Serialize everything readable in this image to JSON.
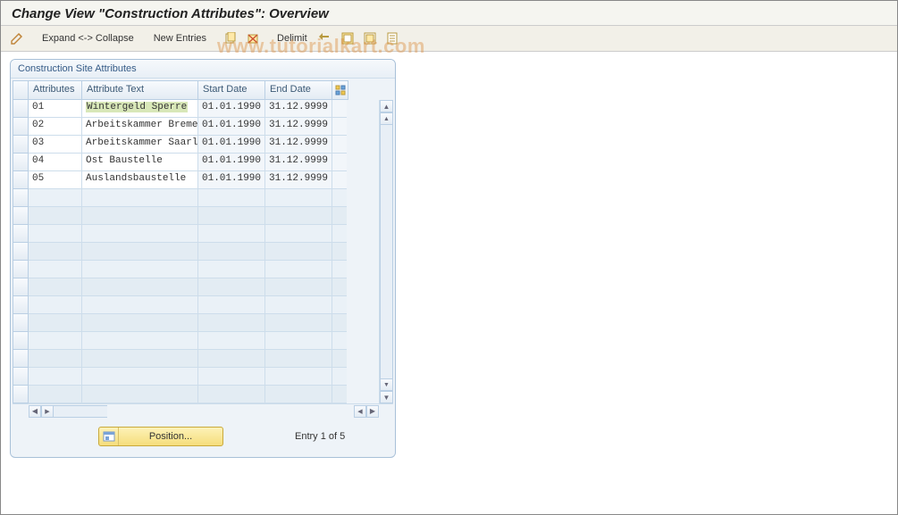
{
  "title": "Change View \"Construction Attributes\": Overview",
  "toolbar": {
    "expand_collapse": "Expand <-> Collapse",
    "new_entries": "New Entries",
    "delimit": "Delimit"
  },
  "panel": {
    "header": "Construction Site Attributes",
    "columns": {
      "attributes": "Attributes",
      "attribute_text": "Attribute Text",
      "start_date": "Start Date",
      "end_date": "End Date"
    },
    "rows": [
      {
        "attr": "01",
        "text": "Wintergeld Sperre",
        "start": "01.01.1990",
        "end": "31.12.9999",
        "selected": true
      },
      {
        "attr": "02",
        "text": "Arbeitskammer Bremen",
        "start": "01.01.1990",
        "end": "31.12.9999",
        "selected": false
      },
      {
        "attr": "03",
        "text": "Arbeitskammer Saarla",
        "start": "01.01.1990",
        "end": "31.12.9999",
        "selected": false
      },
      {
        "attr": "04",
        "text": "Ost Baustelle",
        "start": "01.01.1990",
        "end": "31.12.9999",
        "selected": false
      },
      {
        "attr": "05",
        "text": "Auslandsbaustelle",
        "start": "01.01.1990",
        "end": "31.12.9999",
        "selected": false
      }
    ],
    "empty_rows": 12,
    "position_button": "Position...",
    "entry_status": "Entry 1 of 5"
  },
  "watermark": "www.tutorialkart.com",
  "colors": {
    "panel_border": "#a8c0d8",
    "header_text": "#355b87",
    "accent_yellow": "#f5dd7b"
  }
}
